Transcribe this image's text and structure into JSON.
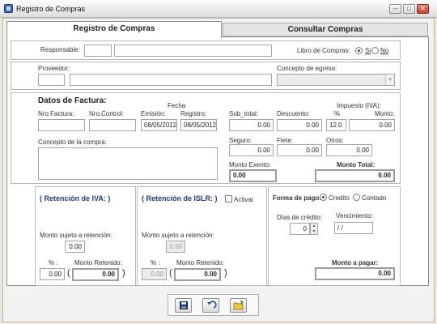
{
  "window": {
    "title": "Registro de Compras"
  },
  "tabs": [
    {
      "label": "Registro de Compras",
      "active": true
    },
    {
      "label": "Consultar Compras",
      "active": false
    }
  ],
  "header": {
    "responsable_label": "Responsable:",
    "responsable_code": "",
    "responsable_name": "",
    "libro_label": "Libro de Compras:",
    "libro_si": "Si",
    "libro_no": "No",
    "libro_value": "Si"
  },
  "proveedor": {
    "label": "Proveedor:",
    "code": "",
    "name": "",
    "concepto_label": "Concepto de egreso:",
    "concepto_value": ""
  },
  "factura": {
    "title": "Datos de Factura:",
    "nro_factura_label": "Nro.Factura:",
    "nro_factura": "",
    "nro_control_label": "Nro.Control:",
    "nro_control": "",
    "fecha_label": "Fecha",
    "emision_label": "Emisión:",
    "emision": "08/05/2012",
    "registro_label": "Registro:",
    "registro": "08/05/2012",
    "subtotal_label": "Sub_total:",
    "subtotal": "0.00",
    "descuento_label": "Descuento:",
    "descuento": "0.00",
    "impuesto_label": "Impuesto (IVA):",
    "pct_label": "%",
    "pct": "12.0",
    "monto_label": "Monto:",
    "monto": "0.00",
    "concepto_label": "Concepto de la compra:",
    "concepto": "",
    "seguro_label": "Seguro:",
    "seguro": "0.00",
    "flete_label": "Flete:",
    "flete": "0.00",
    "otros_label": "Otros:",
    "otros": "0.00",
    "exento_label": "Monto Exento:",
    "exento": "0.00",
    "total_label": "Monto Total:",
    "total": "0.00"
  },
  "ret_iva": {
    "title": "( Retención de IVA: )",
    "sujeto_label": "Monto sujeto a retención:",
    "sujeto": "0.00",
    "pct_label": "% :",
    "pct": "0.00",
    "retenido_label": "Monto Retenido:",
    "retenido": "0.00"
  },
  "ret_islr": {
    "title": "( Retención de ISLR: )",
    "activar_label": "Activar",
    "sujeto_label": "Monto sujeto a retención:",
    "sujeto": "0.00",
    "pct_label": "% :",
    "pct": "0.00",
    "retenido_label": "Monto Retenido:",
    "retenido": "0.00"
  },
  "pago": {
    "forma_label": "Forma de pago:",
    "credito": "Credito",
    "contado": "Contado",
    "selected": "Credito",
    "dias_label": "Días de crédito:",
    "dias": "0",
    "venc_label": "Vencimiento:",
    "venc": " / /",
    "pagar_label": "Monto a pagar:",
    "pagar": "0.00"
  },
  "toolbar": {
    "icons": [
      "save-icon",
      "undo-icon",
      "open-folder-icon"
    ]
  }
}
